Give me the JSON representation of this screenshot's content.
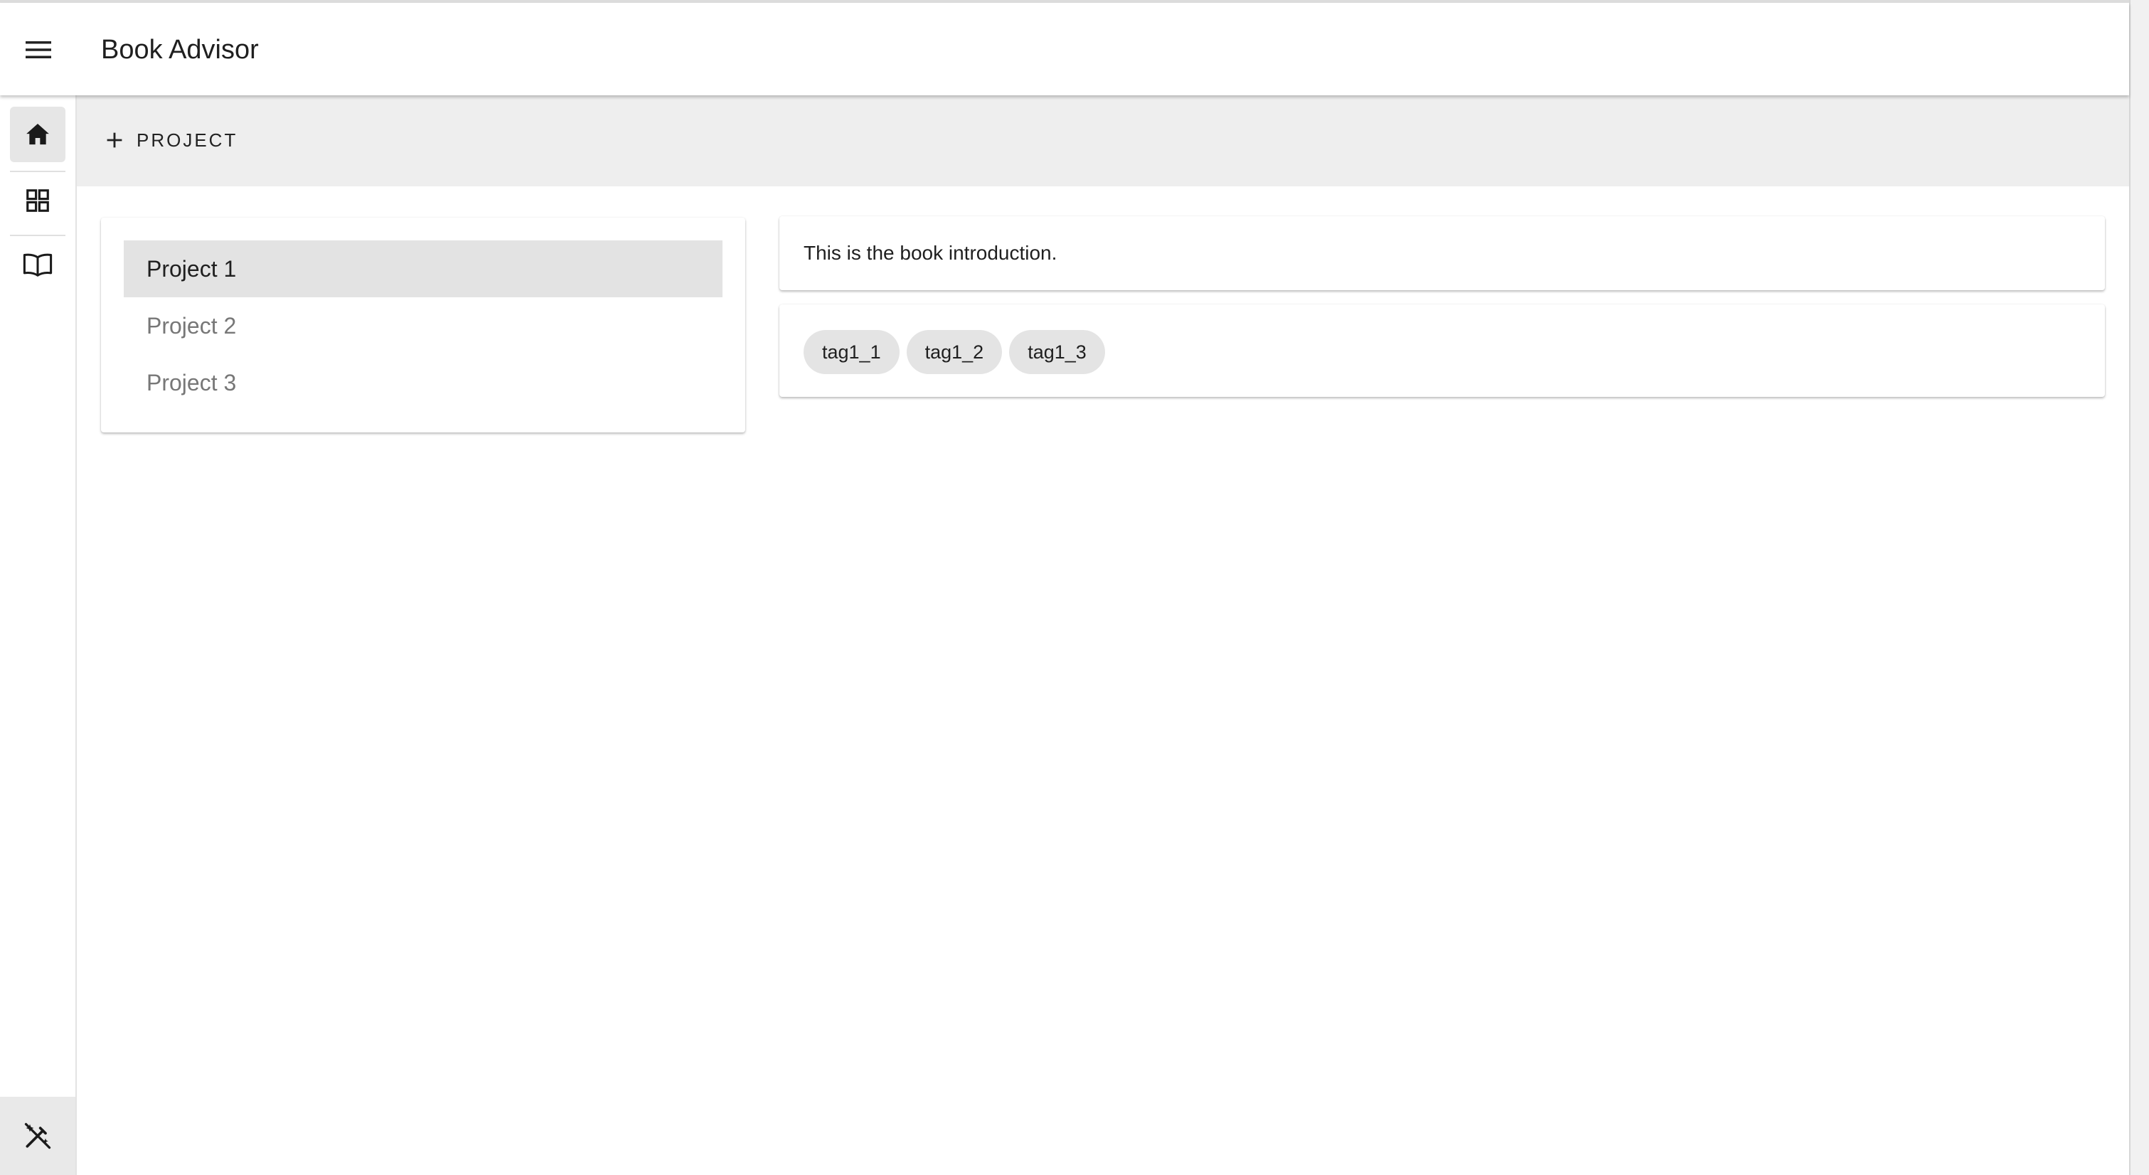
{
  "app": {
    "title": "Book Advisor"
  },
  "icons": {
    "menu": "menu-icon",
    "home": "home-icon",
    "dashboard": "dashboard-grid-icon",
    "book": "book-open-icon",
    "theme_toggle": "auto-fix-off-icon",
    "add": "plus-icon"
  },
  "toolbar": {
    "add_project_label": "PROJECT"
  },
  "projects": {
    "items": [
      {
        "label": "Project 1",
        "selected": true
      },
      {
        "label": "Project 2",
        "selected": false
      },
      {
        "label": "Project 3",
        "selected": false
      }
    ]
  },
  "book": {
    "introduction": "This is the book introduction.",
    "tags": [
      "tag1_1",
      "tag1_2",
      "tag1_3"
    ]
  },
  "colors": {
    "selected_bg": "#e3e3e3",
    "toolbar_bg": "#eeeeee",
    "chip_bg": "#e4e4e4"
  }
}
